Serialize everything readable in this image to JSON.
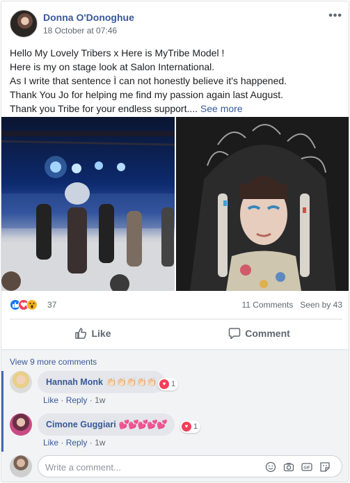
{
  "post": {
    "author": "Donna O'Donoghue",
    "date": "18 October at 07:46",
    "more_icon": "•••",
    "lines": [
      "Hello My Lovely Tribers x Here is MyTribe Model !",
      "Here is my on stage look at Salon International.",
      "As I write that sentence Ì can not honestly believe it's happened.",
      "Thank You Jo for helping me find my passion again last August.",
      "Thank you Tribe for your endless support...."
    ],
    "see_more": "See more"
  },
  "stats": {
    "reactions_count": "37",
    "comments": "11 Comments",
    "seen_by": "Seen by 43",
    "reaction_icons": [
      "like-icon",
      "love-icon",
      "wow-icon"
    ]
  },
  "actions": {
    "like": "Like",
    "comment": "Comment"
  },
  "comments": {
    "view_more": "View 9 more comments",
    "items": [
      {
        "name": "Hannah Monk",
        "body": "👏🏻👏🏻👏🏻👏🏻👏🏻",
        "reaction_count": "1",
        "like": "Like",
        "reply": "Reply",
        "time": "1w"
      },
      {
        "name": "Cimone Guggiari",
        "body": "💕💕💕💕💕",
        "reaction_count": "1",
        "like": "Like",
        "reply": "Reply",
        "time": "1w"
      }
    ],
    "composer_placeholder": "Write a comment..."
  },
  "colors": {
    "link": "#385898",
    "accent": "#4267b2",
    "muted": "#606770",
    "love": "#f33e58"
  }
}
